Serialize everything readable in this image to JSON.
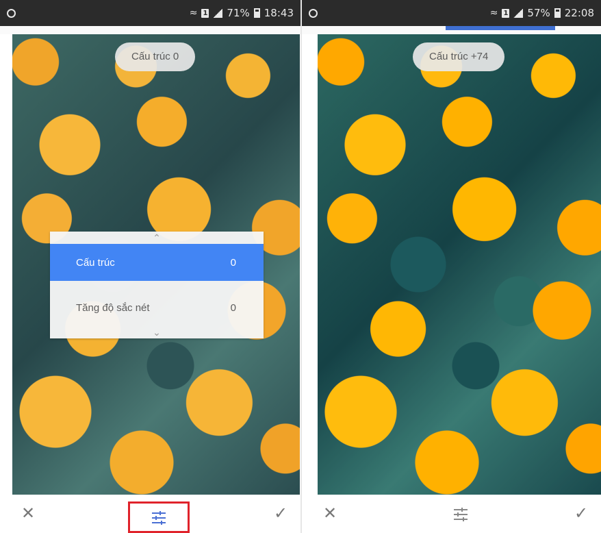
{
  "left": {
    "status": {
      "battery_pct": "71%",
      "time": "18:43"
    },
    "label_pill": "Cấu trúc 0",
    "panel": {
      "rows": [
        {
          "label": "Cấu trúc",
          "value": "0",
          "active": true
        },
        {
          "label": "Tăng độ sắc nét",
          "value": "0",
          "active": false
        }
      ]
    },
    "tune_highlighted": true
  },
  "right": {
    "status": {
      "battery_pct": "57%",
      "time": "22:08"
    },
    "label_pill": "Cấu trúc +74",
    "tune_highlighted": false
  },
  "icons": {
    "close": "close-icon",
    "tune": "tune-icon",
    "check": "check-icon"
  },
  "colors": {
    "accent": "#4285f4",
    "highlight_border": "#e0232b"
  }
}
